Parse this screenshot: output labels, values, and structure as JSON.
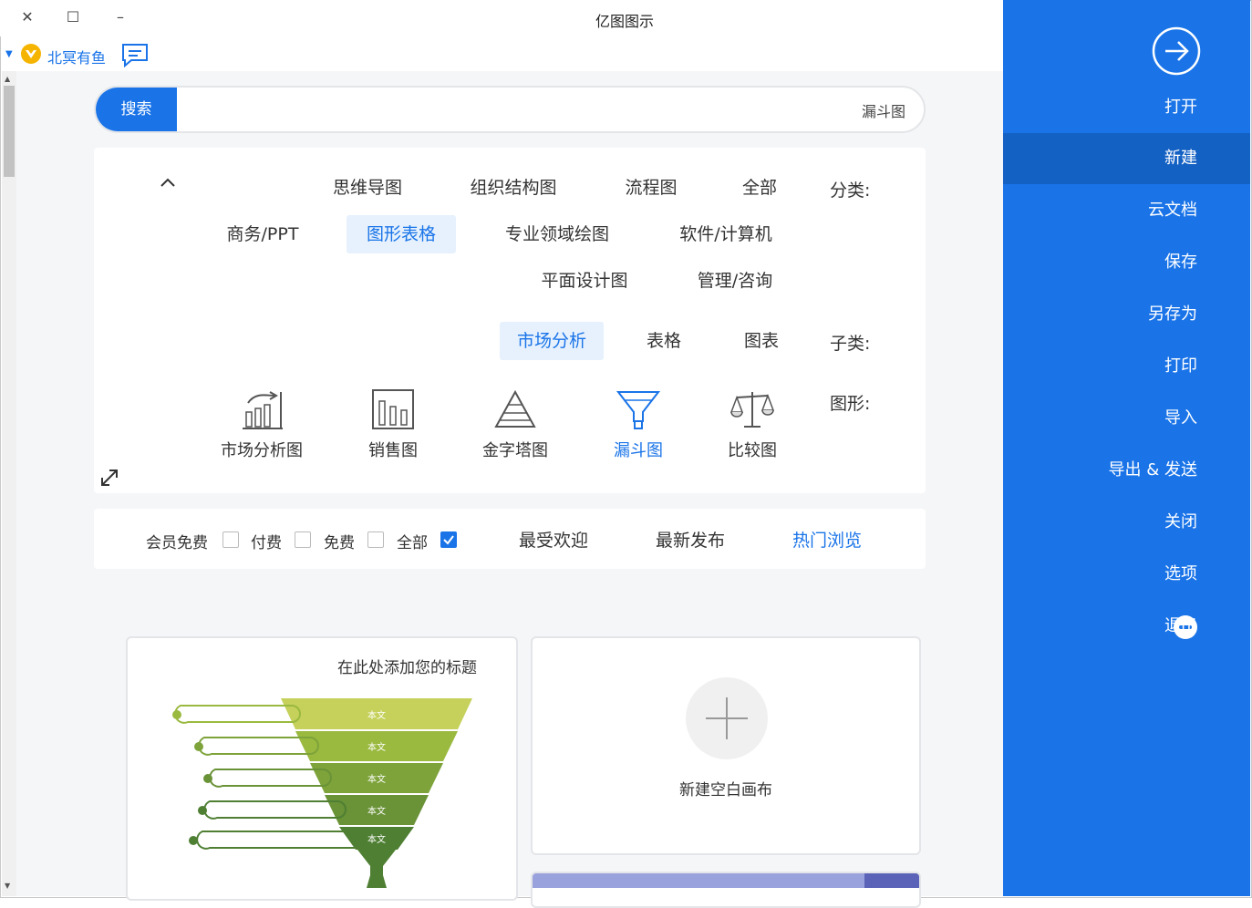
{
  "app": {
    "title": "亿图图示"
  },
  "window": {
    "close_glyph": "✕",
    "maximize_glyph": "☐",
    "minimize_glyph": "–"
  },
  "user": {
    "name": "北冥有鱼",
    "badge_icon": "vip-diamond-icon",
    "chat_icon": "message-icon"
  },
  "search": {
    "button_label": "搜索",
    "value": "漏斗图"
  },
  "filters": {
    "category_label": "分类:",
    "categories": [
      "全部",
      "流程图",
      "组织结构图",
      "思维导图",
      "软件/计算机",
      "专业领域绘图",
      "图形表格",
      "商务/PPT",
      "管理/咨询",
      "平面设计图"
    ],
    "active_category": "图形表格",
    "subcategory_label": "子类:",
    "subcategories": [
      "图表",
      "表格",
      "市场分析"
    ],
    "active_subcategory": "市场分析",
    "shape_label": "图形:",
    "shapes": [
      "比较图",
      "漏斗图",
      "金字塔图",
      "销售图",
      "市场分析图"
    ],
    "active_shape": "漏斗图"
  },
  "sort": {
    "options": [
      "热门浏览",
      "最新发布",
      "最受欢迎"
    ],
    "active": "热门浏览",
    "price_filters": [
      {
        "label": "全部",
        "checked": true
      },
      {
        "label": "免费",
        "checked": false
      },
      {
        "label": "付费",
        "checked": false
      },
      {
        "label": "会员免费",
        "checked": false
      }
    ]
  },
  "cards": {
    "blank_label": "新建空白画布",
    "preview_title": "在此处添加您的标题",
    "funnel_level_label": "本文",
    "funnel_colors": [
      "#c5d15a",
      "#9ab93f",
      "#7da33a",
      "#6a9237",
      "#4f7f33"
    ]
  },
  "menu": {
    "items": [
      "打开",
      "新建",
      "云文档",
      "保存",
      "另存为",
      "打印",
      "导入",
      "导出 & 发送",
      "关闭",
      "选项",
      "退出"
    ],
    "active": "新建",
    "accent": "#1a74e8",
    "active_bg": "#1461c4"
  }
}
